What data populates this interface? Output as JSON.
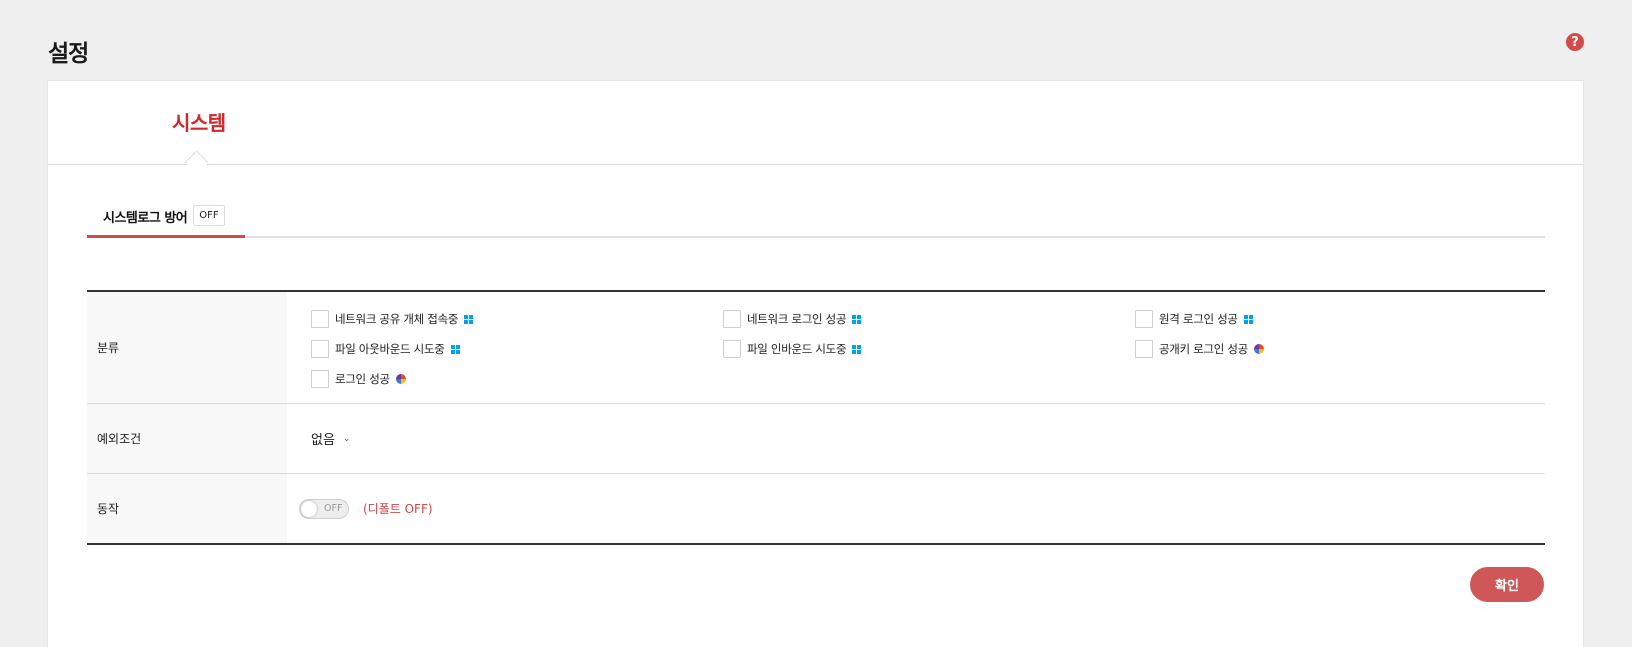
{
  "page": {
    "title": "설정",
    "help_glyph": "?"
  },
  "section_tab": {
    "label": "시스템"
  },
  "subtab": {
    "label": "시스템로그 방어",
    "status": "OFF"
  },
  "form": {
    "category": {
      "label": "분류",
      "options": [
        {
          "label": "네트워크 공유 개체 접속중",
          "os_icon": "windows-icon"
        },
        {
          "label": "네트워크 로그인 성공",
          "os_icon": "windows-icon"
        },
        {
          "label": "원격 로그인 성공",
          "os_icon": "windows-icon"
        },
        {
          "label": "파일 아웃바운드 시도중",
          "os_icon": "windows-icon"
        },
        {
          "label": "파일 인바운드 시도중",
          "os_icon": "windows-icon"
        },
        {
          "label": "공개키 로그인 성공",
          "os_icon": "linux-icon"
        },
        {
          "label": "로그인 성공",
          "os_icon": "linux-icon"
        }
      ]
    },
    "exception": {
      "label": "예외조건",
      "value": "없음"
    },
    "action": {
      "label": "동작",
      "toggle_state": "OFF",
      "default_note": "(디폴트 OFF)"
    }
  },
  "buttons": {
    "confirm": "확인"
  },
  "colors": {
    "accent": "#d0292b",
    "button": "#cf5757",
    "windows": "#00a1f1"
  }
}
